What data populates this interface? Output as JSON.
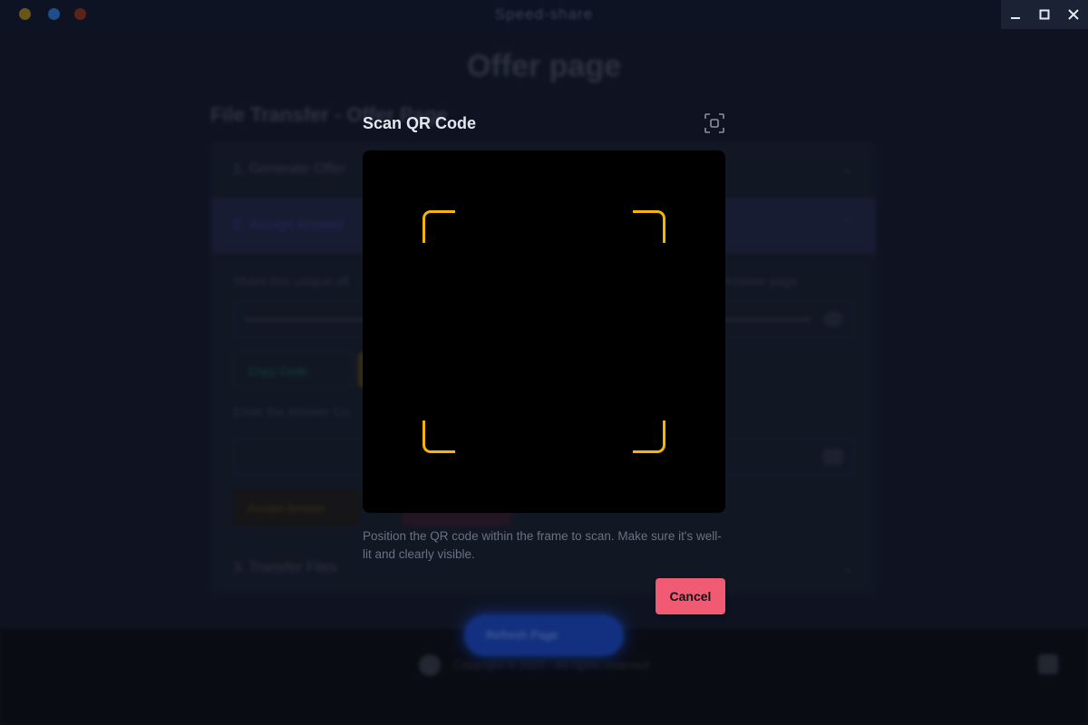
{
  "window": {
    "app_title": "Speed-share",
    "controls": [
      "minimize",
      "maximize",
      "close"
    ]
  },
  "background": {
    "page_heading": "Offer page",
    "section_title": "File Transfer - Offer Page",
    "accordion": [
      {
        "label": "1. Generate Offer",
        "expanded": false
      },
      {
        "label": "2. Accept Answer",
        "expanded": true
      },
      {
        "label": "3. Transfer Files",
        "expanded": false
      }
    ],
    "share_text_start": "Share this unique off",
    "share_text_end": "Answer page",
    "copy_code_label": "Copy Code",
    "enter_answer_text": "Enter the Answer Co",
    "accept_answer_label": "Accept Answer",
    "refresh_label": "Refresh Page",
    "copyright": "Copyright © 2025 - All rights reserved"
  },
  "modal": {
    "title": "Scan QR Code",
    "instructions": "Position the QR code within the frame to scan. Make sure it's well-lit and clearly visible.",
    "cancel_label": "Cancel",
    "frame_color": "#f5b30b",
    "cancel_color": "#f05a72"
  }
}
